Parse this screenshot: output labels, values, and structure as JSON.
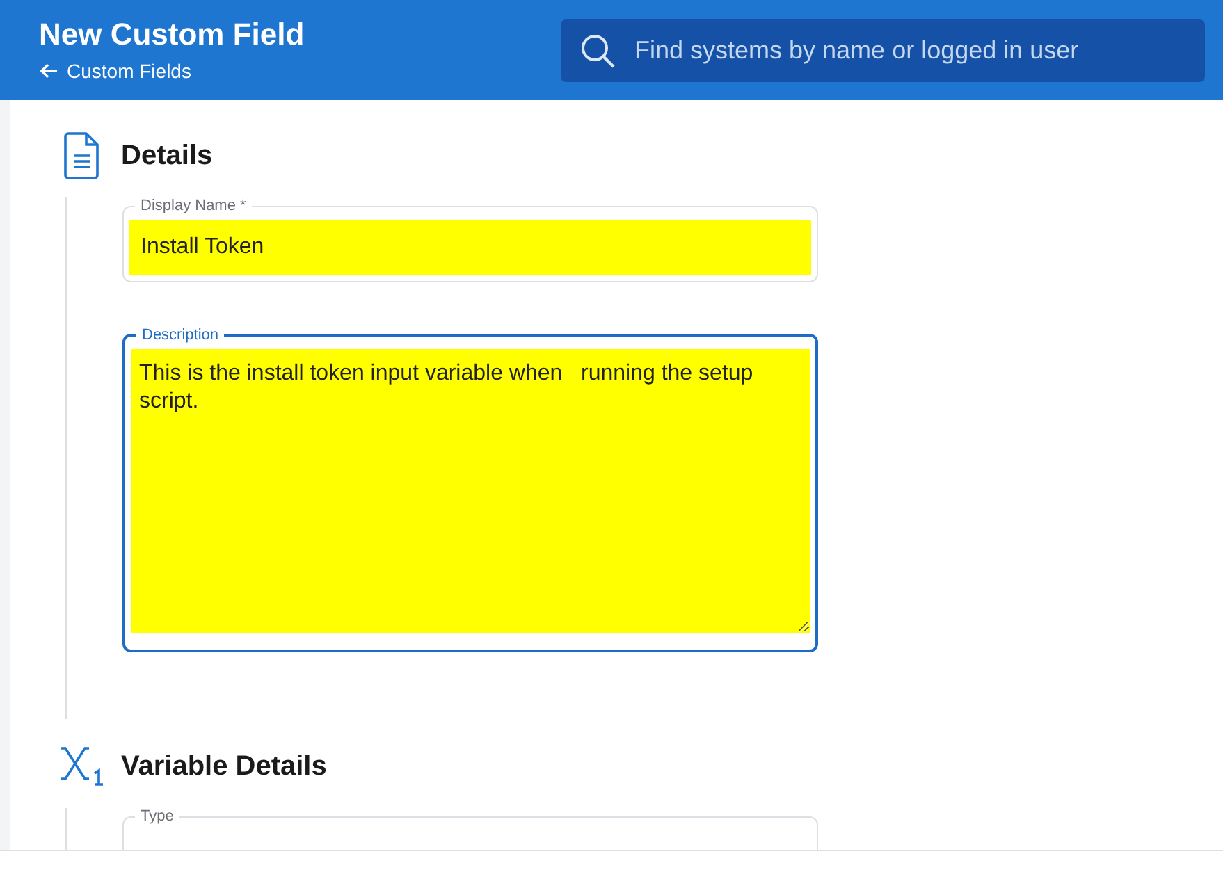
{
  "header": {
    "title": "New Custom Field",
    "back_link": "Custom Fields",
    "search": {
      "placeholder": "Find systems by name or logged in user"
    }
  },
  "sections": [
    {
      "title": "Details",
      "kind": "document",
      "fields": [
        {
          "kind": "input",
          "label": "Display Name *",
          "value": "Install Token",
          "focused": false
        },
        {
          "kind": "textarea",
          "label": "Description",
          "value": "This is the install token input variable when   running the setup script.",
          "focused": true
        }
      ]
    },
    {
      "title": "Variable Details",
      "kind": "variable",
      "fields": [
        {
          "kind": "select",
          "label": "Type",
          "focused": false
        }
      ]
    }
  ]
}
